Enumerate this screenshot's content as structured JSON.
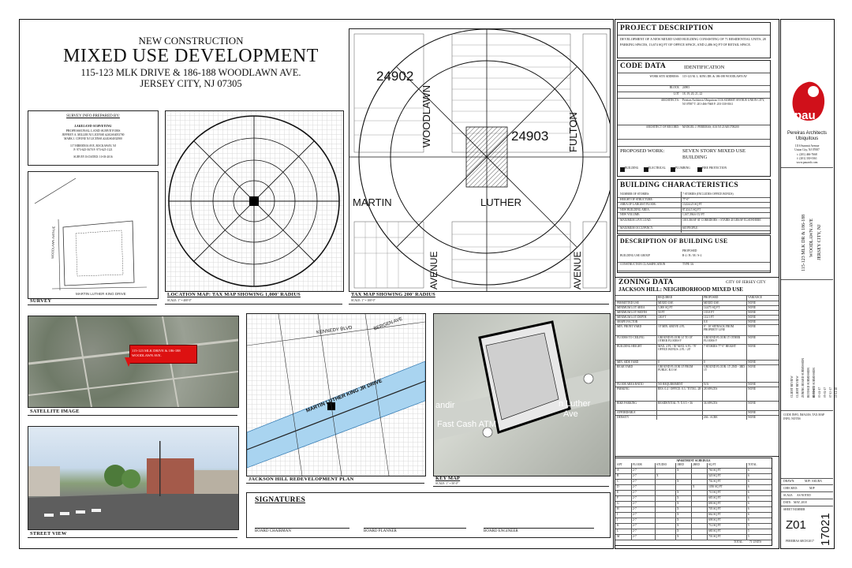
{
  "title_block": {
    "kicker": "NEW CONSTRUCTION",
    "title": "MIXED USE DEVELOPMENT",
    "address": "115-123 MLK DRIVE & 186-188 WOODLAWN AVE.",
    "city": "JERSEY CITY, NJ 07305"
  },
  "survey_info": {
    "heading": "SURVEY INFO PREPARED BY:",
    "firm": "LAKELAND SURVEYING",
    "role": "PROFESSIONAL LAND SURVEYORS",
    "line1": "JEFFREY A. MILLER NJ LICENSE #24GS04053700",
    "line2": "MARK J. CIFONE NJ LICENSE #24GS04032900",
    "line3": "117 HIBERNIA AVE, ROCKAWAY, NJ",
    "line4": "P: 973-625-5670 F: 973-625-1121",
    "line5": "SURVEY IS DATED: 10-03-2016"
  },
  "captions": {
    "survey": "SURVEY",
    "location_map": "LOCATION MAP: TAX MAP SHOWING 1,000' RADIUS",
    "location_scale": "SCALE: 1\" = 400'-0\"",
    "tax_map": "TAX MAP SHOWING 200' RADIUS",
    "tax_scale": "SCALE: 1\" = 100'-0\"",
    "satellite": "SATELLITE IMAGE",
    "redevelopment": "JACKSON HILL REDEVELOPMENT PLAN",
    "key_map": "KEY MAP",
    "key_scale": "SCALE: 1\" = 50'-0\"",
    "street_view": "STREET VIEW"
  },
  "satellite": {
    "callout": "115-123 MLK DRIVE & 186-188 WOODLAWN AVE."
  },
  "tax_map_labels": {
    "block_a": "24902",
    "block_b": "24903",
    "street_woodlawn": "WOODLAWN",
    "street_fulton": "FULTON",
    "street_martin": "MARTIN",
    "street_luther": "LUTHER",
    "street_avenue": "AVENUE",
    "street_avenue2": "AVENUE"
  },
  "redev_labels": {
    "kennedy": "KENNEDY BLVD",
    "mlk": "MARTIN LUTHER KING JR DRIVE",
    "bergen": "BERGEN AVE"
  },
  "keymap_labels": {
    "luther": "n Luther",
    "atm": "Fast Cash ATM",
    "ave": "Ave",
    "shop": "andir"
  },
  "signatures": {
    "heading": "SIGNATURES",
    "chairman": "BOARD CHAIRMAN",
    "planner": "BOARD PLANNER",
    "engineer": "BOARD ENGINEER"
  },
  "project_description": {
    "heading": "PROJECT DESCRIPTION",
    "text": "DEVELOPMENT OF A NEW MIXED USED BUILDING CONSISTING OF 71 RESIDENTIAL UNITS, 28 PARKING SPACES, 13,674 SQ FT OF OFFICE SPACE, AND 2,486 SQ FT OF RETAIL SPACE."
  },
  "code_data": {
    "heading": "CODE DATA",
    "sub": "IDENTIFICATION",
    "rows": [
      {
        "k": "WORK SITE ADDRESS:",
        "v": "115-123 M. L. KING DR. & 186-188 WOODLAWN AV"
      },
      {
        "k": "BLOCK",
        "v": "24903"
      },
      {
        "k": "LOT",
        "v": "18, 19, 20, 21, 22"
      },
      {
        "k": "ARCHITECTS:",
        "v": "Pereiras Architects Ubiquitous 1116 SUMMIT AVENUE UNION CITY, NJ 07087 T: 201-466-7668 F: 201-330-0161"
      },
      {
        "k": "ARCHITECT OF RECORD:",
        "v": "MANUEL J. PEREIRAS, AIA NJ 21AI01708200"
      }
    ],
    "proposed_label": "PROPOSED WORK:",
    "proposed_value": "SEVEN STORY MIXED USE BUILDING",
    "checks": [
      "BUILDING",
      "ELECTRICAL",
      "PLUMBING",
      "FIRE PROTECTION"
    ]
  },
  "building_characteristics": {
    "heading": "BUILDING CHARACTERISTICS",
    "rows": [
      {
        "k": "NUMBER OF STORIES:",
        "v": "7 STORIES (INCLUDES OFFICE BONUS)"
      },
      {
        "k": "HEIGHT OF STRUCTURE:",
        "v": "77'-0\""
      },
      {
        "k": "AREA OF LARGEST FLOOR:",
        "v": "13,024.25 SQ FT"
      },
      {
        "k": "NEW BUILDING AREA:",
        "v": "87,434.5 SQ FT"
      },
      {
        "k": "NEW VOLUME:",
        "v": "1,167,394.6 CU FT"
      },
      {
        "k": "MAXIMUM LIVE LOAD:",
        "v": "100 LBS/SF AT CORRIDORS + STAIRS 40 LBS/SF ELSEWHERE"
      },
      {
        "k": "MAXIMUM OCCUPANCY:",
        "v": "665 PEOPLE"
      }
    ]
  },
  "building_use": {
    "heading": "DESCRIPTION OF BUILDING USE",
    "proposed": "PROPOSED",
    "rows": [
      {
        "k": "BUILDING USE GROUP",
        "v": "R-2 / B / M / S-2"
      },
      {
        "k": "CONSTRUCTION CLASSIFICATION",
        "v": "TYPE 3A"
      }
    ]
  },
  "zoning": {
    "heading": "ZONING DATA",
    "city": "CITY OF JERSEY CITY",
    "district": "JACKSON HILL: NEIGHBORHOOD MIXED USE",
    "cols": [
      "REQUIRED",
      "PROPOSED",
      "VARIANCE"
    ],
    "rows": [
      {
        "k": "PERMITTED USE",
        "r": "MIXED USE",
        "p": "MIXED USE",
        "v": "NONE"
      },
      {
        "k": "MINIMUM LOT AREA",
        "r": "5,000 SQ FT",
        "p": "14,675 SQ FT",
        "v": "NONE"
      },
      {
        "k": "MINIMUM LOT WIDTH",
        "r": "50 FT",
        "p": "135.8 FT",
        "v": "NONE"
      },
      {
        "k": "MINIMUM LOT DEPTH",
        "r": "100 FT",
        "p": "112.5 FT",
        "v": "NONE"
      },
      {
        "k": "SHAPE FACTOR",
        "r": "",
        "p": "0.8",
        "v": "NONE"
      },
      {
        "k": "MIN. FRONT YARD",
        "r": "10' MIN. ABOVE 4 FL",
        "p": "0' - 10' SETBACK FROM PROPERTY LINE",
        "v": "NONE"
      },
      {
        "k": "FLOORS TO CEILING",
        "r": "GROUND FLOOR 14' TO 18' OTHER FLOORS 9'",
        "p": "GROUND FLOOR 15' OTHER FLOORS 9'",
        "v": "NONE"
      },
      {
        "k": "BUILDING HEIGHT",
        "r": "MAX. 4 FL / 50' MAX. 6 FL / 70' OFFICE BONUS: 2 FL / 20'",
        "p": "7 STORIES 77'-0\" HEIGHT",
        "v": "NONE"
      },
      {
        "k": "MIN. SIDE YARD",
        "r": "0",
        "p": "0",
        "v": "NONE"
      },
      {
        "k": "REAR YARD",
        "r": "GROUND FLOOR 10' FROM PUBLIC R.O.W.",
        "p": "GROUND FLOOR: 15' 2ND - 3RD: 15'",
        "v": "NONE"
      },
      {
        "k": "FLOOR AREA RATIO",
        "r": "NO REQUIREMENT",
        "p": "N/A",
        "v": "NONE"
      },
      {
        "k": "PARKING",
        "r": "RES: 0.4 / OFFICE: 0.3 / TOTAL: 28",
        "p": "28 SPACES",
        "v": "NONE"
      },
      {
        "k": "BIKE PARKING",
        "r": "RESIDENTIAL 71 X 0.5 = 36",
        "p": "36 SPACES",
        "v": "NONE"
      },
      {
        "k": "AFFORDABLE",
        "r": "",
        "p": "",
        "v": "NONE"
      },
      {
        "k": "DENSITY",
        "r": "",
        "p": "204 / ACRE",
        "v": "NONE"
      }
    ]
  },
  "apartment_schedule": {
    "heading": "APARTMENT SCHEDULE",
    "cols": [
      "APT",
      "FLOOR",
      "STUDIO",
      "1BED",
      "2BED",
      "SQ FT",
      "TOTAL"
    ],
    "rows": [
      [
        "A",
        "2-7",
        "",
        "X",
        "",
        "760 SQ FT",
        "6"
      ],
      [
        "B",
        "2-7",
        "X",
        "",
        "",
        "520 SQ FT",
        "6"
      ],
      [
        "C",
        "2-7",
        "",
        "X",
        "",
        "702 SQ FT",
        "6"
      ],
      [
        "D",
        "2-7",
        "",
        "",
        "X",
        "1050 SQ FT",
        "6"
      ],
      [
        "E",
        "2-7",
        "",
        "X",
        "",
        "710 SQ FT",
        "6"
      ],
      [
        "F",
        "2-7",
        "",
        "X",
        "",
        "685 SQ FT",
        "6"
      ],
      [
        "G",
        "2-7",
        "",
        "X",
        "",
        "690 SQ FT",
        "6"
      ],
      [
        "H",
        "2-7",
        "",
        "X",
        "",
        "705 SQ FT",
        "6"
      ],
      [
        "I",
        "2-7",
        "",
        "X",
        "",
        "662 SQ FT",
        "6"
      ],
      [
        "J",
        "2-7",
        "",
        "X",
        "",
        "698 SQ FT",
        "6"
      ],
      [
        "K",
        "2-7",
        "",
        "X",
        "",
        "712 SQ FT",
        "5"
      ],
      [
        "L",
        "2-7",
        "",
        "X",
        "",
        "680 SQ FT",
        "5"
      ],
      [
        "M",
        "2-7",
        "",
        "X",
        "",
        "701 SQ FT",
        "5"
      ]
    ],
    "total_label": "TOTAL",
    "total_value": "71 UNITS"
  },
  "firm": {
    "logo": "pau",
    "name": "Pereiras Architects Ubiquitous",
    "addr1": "1116 Summit Avenue",
    "addr2": "Union City, NJ 07087",
    "phone": "t: (201) 466-7668",
    "fax": "f: (201) 330-0161",
    "web": "www.pauarch.com"
  },
  "side_project": {
    "line1": "115-123 MLK DR & 186-188",
    "line2": "WOODLAWN AVE",
    "line3": "JERSEY CITY, NJ"
  },
  "revisions": [
    {
      "date": "03-10-17",
      "note": "CLIENT REVIEW"
    },
    {
      "date": "03-24-17",
      "note": "CLIENT REVIEW"
    },
    {
      "date": "05-02-17",
      "note": "ZONING BOARD SUBMISSION"
    },
    {
      "date": "07-13-17",
      "note": "REVISED SUBMISSION"
    },
    {
      "date": "10-11-18",
      "note": "REVISED SUBMISSION"
    }
  ],
  "sheet_info": {
    "code": "CODE INFO, IMAGES, TAX MAP INFO, NOTES",
    "drawn_label": "DRAWN:",
    "drawn": "MJP / AKUBA",
    "checked_label": "CHECKED:",
    "checked": "MJP",
    "scale_label": "SCALE:",
    "scale": "AS NOTED",
    "date_label": "DATE:",
    "date": "MAY, 2018",
    "sheet_label": "SHEET NUMBER",
    "sheet": "Z01",
    "project_no": "17021",
    "copyright": "PEREIRAS ARCH 2017"
  }
}
